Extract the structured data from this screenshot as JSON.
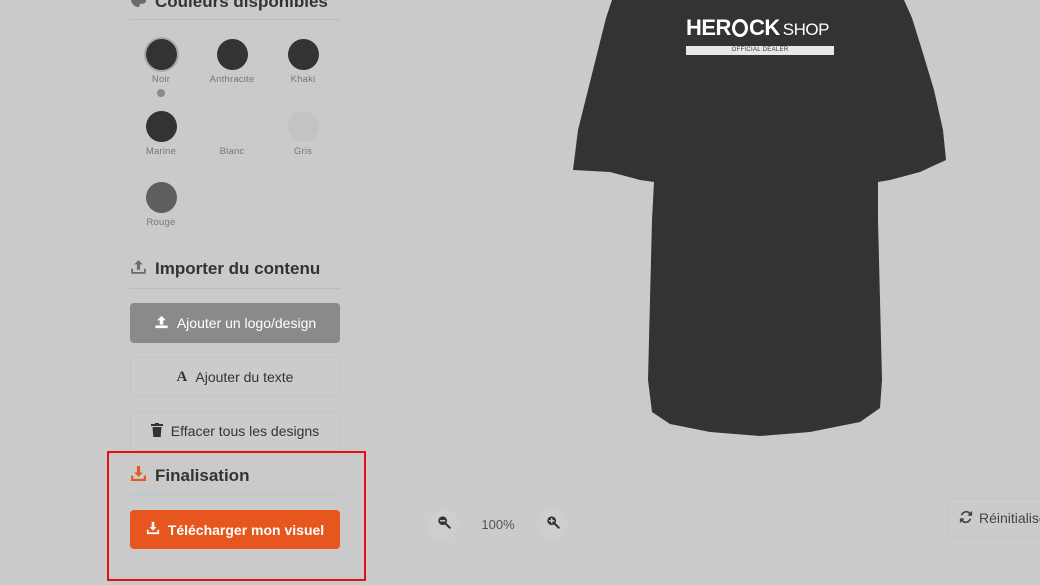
{
  "sections": {
    "colors_title": "Couleurs disponibles",
    "import_title": "Importer du contenu",
    "final_title": "Finalisation"
  },
  "colors": [
    {
      "name": "Noir",
      "hex": "#333333",
      "selected": true
    },
    {
      "name": "Anthracite",
      "hex": "#333333",
      "selected": false
    },
    {
      "name": "Khaki",
      "hex": "#333333",
      "selected": false
    },
    {
      "name": "Marine",
      "hex": "#333333",
      "selected": false
    },
    {
      "name": "Blanc",
      "hex": "#cbcbcb",
      "selected": false
    },
    {
      "name": "Gris",
      "hex": "#c3c3c3",
      "selected": false
    },
    {
      "name": "Rouge",
      "hex": "#5e5e5e",
      "selected": false
    }
  ],
  "buttons": {
    "add_logo": "Ajouter un logo/design",
    "add_text": "Ajouter du texte",
    "clear_designs": "Effacer tous les designs",
    "download": "Télécharger mon visuel",
    "reset": "Réinitialiser"
  },
  "zoom": {
    "value": "100%"
  },
  "product": {
    "brand_main": "HER",
    "brand_main2": "CK",
    "brand_shop": "SHOP",
    "brand_sub": "OFFICIAL DEALER",
    "shirt_color": "#333333"
  },
  "accent": "#e8561f",
  "highlight_color": "#e3101b"
}
